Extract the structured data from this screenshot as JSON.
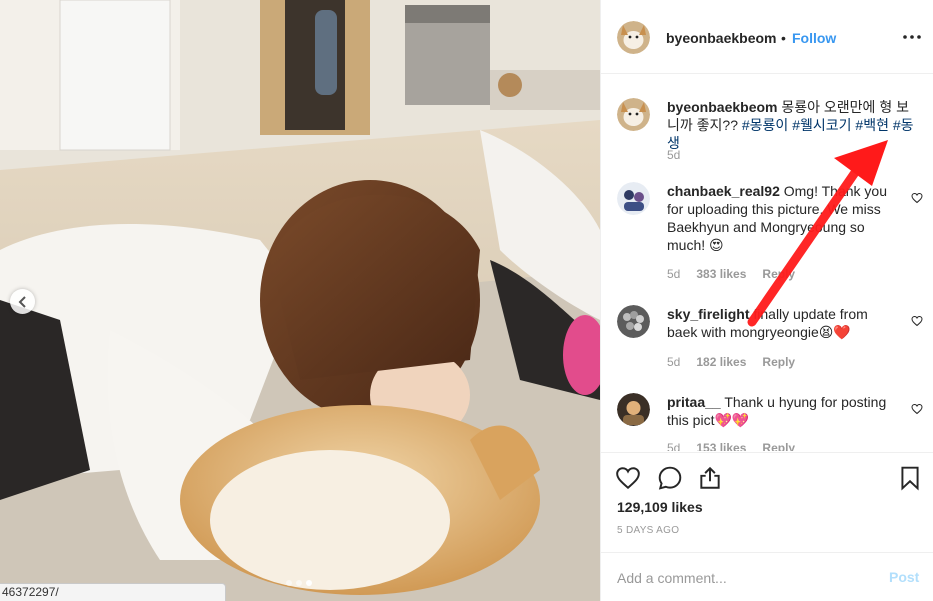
{
  "post": {
    "owner": "byeonbaekbeom",
    "separator": "•",
    "follow_label": "Follow",
    "more_icon": "more-options-icon"
  },
  "caption": {
    "user": "byeonbaekbeom",
    "text": "몽룡아 오랜만에 형 보니까 좋지??",
    "tags": [
      "#몽룡이",
      "#웰시코기",
      "#백현",
      "#동생"
    ],
    "time": "5d"
  },
  "comments": [
    {
      "user": "chanbaek_real92",
      "text": "Omg! Thank you for uploading this picture. We miss Baekhyun and Mongryeoung so much! 😍",
      "time": "5d",
      "likes": "383 likes",
      "reply": "Reply"
    },
    {
      "user": "sky_firelight",
      "text": "finally update from baek with mongryeongie😫❤️",
      "time": "5d",
      "likes": "182 likes",
      "reply": "Reply"
    },
    {
      "user": "pritaa__",
      "text": "Thank u hyung for posting this pict💖💖",
      "time": "5d",
      "likes": "153 likes",
      "reply": "Reply"
    }
  ],
  "actions": {
    "like_icon": "heart-icon",
    "comment_icon": "comment-icon",
    "share_icon": "share-icon",
    "save_icon": "bookmark-icon"
  },
  "likes": "129,109 likes",
  "ago": "5 DAYS AGO",
  "add_comment": {
    "placeholder": "Add a comment...",
    "post_label": "Post"
  },
  "carousel": {
    "total": 3,
    "active": 3
  },
  "status_url": "46372297/",
  "colors": {
    "accent": "#3897f0",
    "hashtag": "#003569",
    "post_disabled": "#b2dffc",
    "annotation": "#ff1a1a"
  }
}
